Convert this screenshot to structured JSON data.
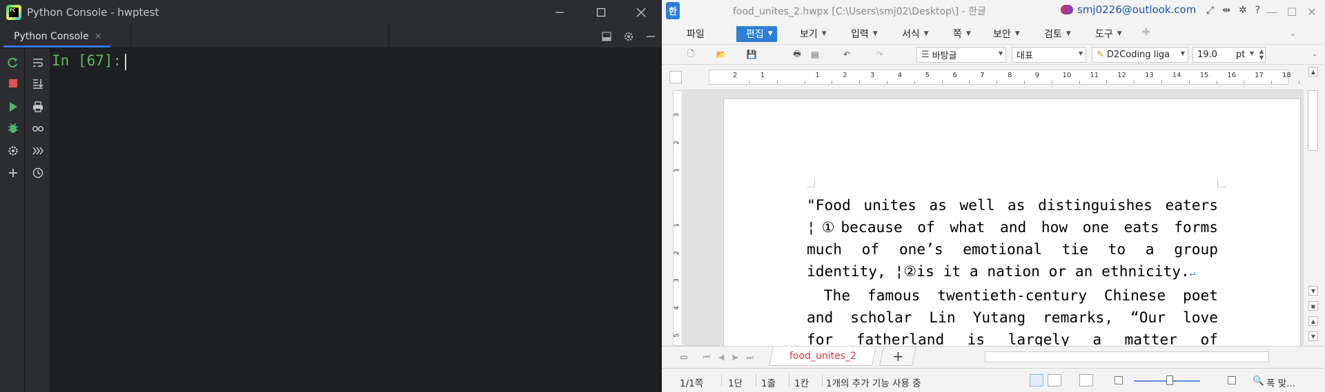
{
  "pycharm": {
    "window_title": "Python Console - hwptest",
    "logo_text": "PC",
    "tab_label": "Python Console",
    "prompt": "In [67]:"
  },
  "hwp": {
    "window_title": "food_unites_2.hwpx [C:\\Users\\smj02\\Desktop\\] - 한글",
    "logo_text": "한",
    "account": "smj0226@outlook.com",
    "menus": [
      "파일",
      "편집",
      "보기",
      "입력",
      "서식",
      "쪽",
      "보안",
      "검토",
      "도구"
    ],
    "style_value": "바탕글",
    "lang_value": "대표",
    "font_value": "D2Coding liga",
    "size_value": "19.0",
    "size_unit": "pt",
    "ruler_numbers": [
      "2",
      "1",
      "",
      "1",
      "2",
      "3",
      "4",
      "5",
      "6",
      "7",
      "8",
      "9",
      "10",
      "11",
      "12",
      "13",
      "14",
      "15",
      "16",
      "17",
      "18"
    ],
    "vruler_numbers": [
      "3",
      "2",
      "1",
      "",
      "1",
      "2",
      "3",
      "4",
      "5"
    ],
    "doc_lines": [
      "\"Food unites as well as distinguishes eaters",
      "¦①because of what and how one eats forms",
      "much of one’s emotional tie to a group",
      "identity, ¦②is it a nation or an ethnicity.",
      " The famous twentieth-century Chinese poet",
      "and scholar Lin Yutang remarks, “Our love",
      "for fatherland is largely a matter of"
    ],
    "sheet_tab": "food_unites_2",
    "status": {
      "page": "1/1쪽",
      "col": "1단",
      "line": "1줄",
      "pos": "1칸",
      "message": "1개의 추가 기능 사용 중",
      "zoom": "폭 맞..."
    },
    "accent": "#2b7fd6"
  }
}
